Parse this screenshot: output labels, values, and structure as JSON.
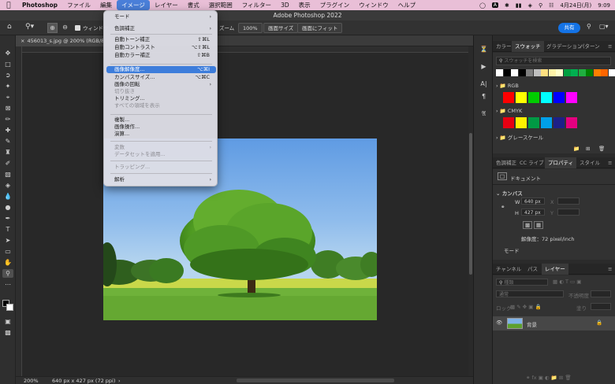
{
  "menubar": {
    "items": [
      "Photoshop",
      "ファイル",
      "編集",
      "イメージ",
      "レイヤー",
      "書式",
      "選択範囲",
      "フィルター",
      "3D",
      "表示",
      "プラグイン",
      "ウィンドウ",
      "ヘルプ"
    ],
    "date": "4月24日(月)",
    "time": "9:09",
    "input_badge": "A"
  },
  "window": {
    "title": "Adobe Photoshop 2022"
  },
  "options_bar": {
    "window_label": "ウィンドウ",
    "zoom_label": "ズーム",
    "zoom_value": "100%",
    "fill_screen": "画面サイズ",
    "fit_screen": "画面にフィット",
    "share": "共有"
  },
  "document": {
    "tab_title": "456013_s.jpg @ 200% (RGB/8*",
    "status_zoom": "200%",
    "status_info": "640 px x 427 px (72 ppi)"
  },
  "menu": {
    "items": [
      {
        "label": "モード",
        "submenu": true
      },
      {
        "label": "色調補正",
        "submenu": true
      },
      {
        "label": "自動トーン補正",
        "shortcut": "⇧⌘L"
      },
      {
        "label": "自動コントラスト",
        "shortcut": "⌥⇧⌘L"
      },
      {
        "label": "自動カラー補正",
        "shortcut": "⇧⌘B"
      },
      {
        "label": "画像解像度...",
        "shortcut": "⌥⌘I",
        "highlighted": true
      },
      {
        "label": "カンバスサイズ...",
        "shortcut": "⌥⌘C"
      },
      {
        "label": "画像の回転",
        "submenu": true
      },
      {
        "label": "切り抜き",
        "disabled": true
      },
      {
        "label": "トリミング..."
      },
      {
        "label": "すべての領域を表示",
        "disabled": true
      },
      {
        "label": "複製..."
      },
      {
        "label": "画像操作..."
      },
      {
        "label": "演算..."
      },
      {
        "label": "変数",
        "submenu": true,
        "disabled": true
      },
      {
        "label": "データセットを適用...",
        "disabled": true
      },
      {
        "label": "トラッピング...",
        "disabled": true
      },
      {
        "label": "解析",
        "submenu": true
      }
    ]
  },
  "swatches_panel": {
    "tabs": [
      "カラー",
      "スウォッチ",
      "グラデーション",
      "パターン"
    ],
    "search_placeholder": "スウォッチを検索",
    "groups": [
      {
        "name": "RGB",
        "colors": [
          "#ff0000",
          "#ffff00",
          "#00cc00",
          "#00ffff",
          "#0000ff",
          "#ff00ff"
        ]
      },
      {
        "name": "CMYK",
        "colors": [
          "#e60012",
          "#fff100",
          "#009944",
          "#00a0e9",
          "#1d2088",
          "#e4007f"
        ]
      },
      {
        "name": "グレースケール",
        "colors": []
      }
    ],
    "top_row": [
      "#ffffff",
      "#000000",
      "#ffffff",
      "#000000",
      "#7f7f7f",
      "#bfbfbf",
      "#ffe080",
      "#fff3a8",
      "#ffffcc",
      "#00a040",
      "#00b050",
      "#20b040",
      "#008000",
      "#ff8000",
      "#ff6600",
      "#ffffff"
    ]
  },
  "properties_panel": {
    "tabs": [
      "色調補正",
      "CC ライブ",
      "プロパティ",
      "スタイル"
    ],
    "kind": "ドキュメント",
    "section": "カンバス",
    "w_label": "W",
    "w_value": "640 px",
    "h_label": "H",
    "h_value": "427 px",
    "x_label": "X",
    "y_label": "Y",
    "resolution": "解像度：72 pixel/inch",
    "mode_label": "モード"
  },
  "layers_panel": {
    "tabs": [
      "チャンネル",
      "パス",
      "レイヤー"
    ],
    "filter": "種類",
    "blend_mode": "通常",
    "opacity_label": "不透明度",
    "lock_label": "ロック",
    "fill_label": "塗り",
    "layer_name": "背景"
  }
}
